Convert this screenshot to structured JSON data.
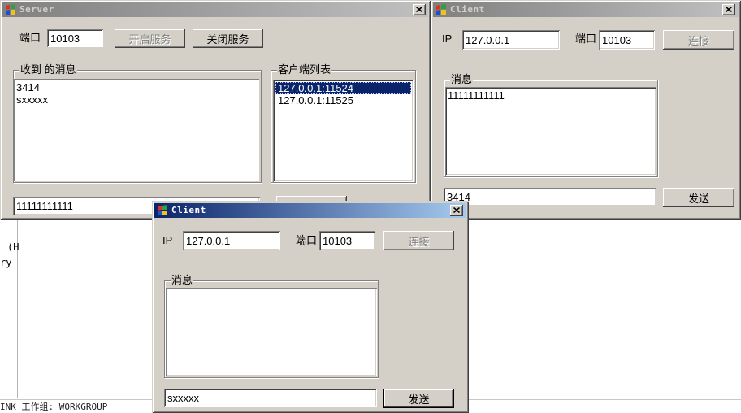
{
  "colors": {
    "window_bg": "#D4D0C8",
    "active_title_start": "#0A246A",
    "active_title_end": "#A6CAF0",
    "inactive_title_start": "#808080",
    "inactive_title_end": "#C0C0C0",
    "inactive_title_text": "#D4D0C8",
    "selection": "#0A246A",
    "disabled_text": "#808080"
  },
  "icons": {
    "app": "app-icon",
    "close": "close-icon"
  },
  "background": {
    "fragment_1": "(H",
    "fragment_2": "ry",
    "status": "INK 工作组: WORKGROUP"
  },
  "server": {
    "title": "Server",
    "active": false,
    "port_label": "端口",
    "port_value": "10103",
    "start_button": {
      "label": "开启服务",
      "enabled": false
    },
    "stop_button": {
      "label": "关闭服务",
      "enabled": true
    },
    "messages_label": "收到 的消息",
    "messages": [
      "3414",
      "sxxxxx"
    ],
    "clients_label": "客户端列表",
    "clients": [
      "127.0.0.1:11524",
      "127.0.0.1:11525"
    ],
    "selected_client": 0,
    "send_value": "11111111111"
  },
  "client_right": {
    "title": "Client",
    "active": false,
    "ip_label": "IP",
    "ip_value": "127.0.0.1",
    "port_label": "端口",
    "port_value": "10103",
    "connect_button": {
      "label": "连接",
      "enabled": false
    },
    "messages_label": "消息",
    "messages": [
      "11111111111"
    ],
    "send_value": "3414",
    "send_button": {
      "label": "发送",
      "enabled": true,
      "default": false
    }
  },
  "client_active": {
    "title": "Client",
    "active": true,
    "ip_label": "IP",
    "ip_value": "127.0.0.1",
    "port_label": "端口",
    "port_value": "10103",
    "connect_button": {
      "label": "连接",
      "enabled": false
    },
    "messages_label": "消息",
    "messages": [],
    "send_value": "sxxxxx",
    "send_button": {
      "label": "发送",
      "enabled": true,
      "default": true
    }
  }
}
